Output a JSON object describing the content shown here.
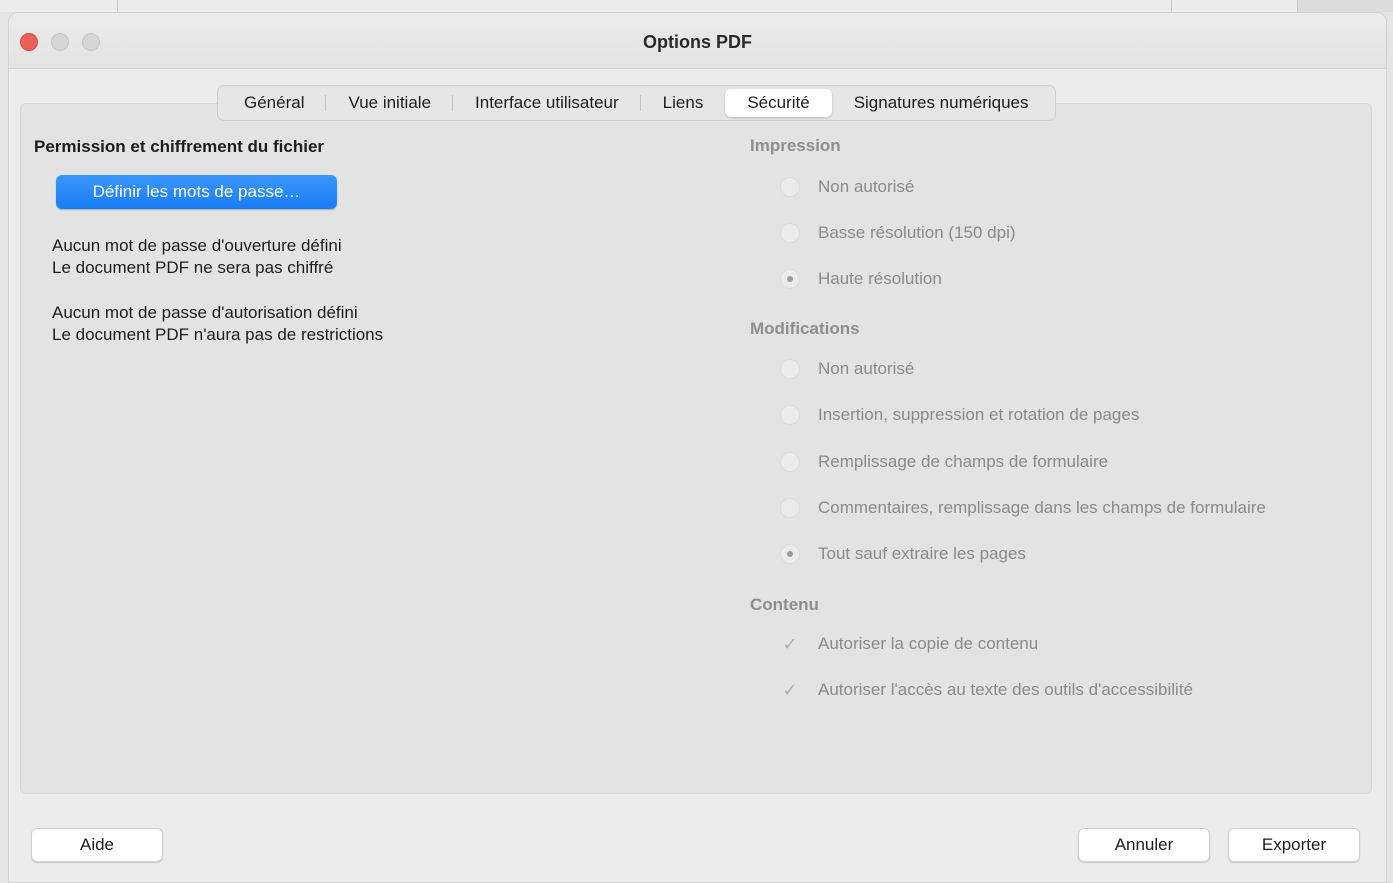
{
  "window": {
    "title": "Options PDF"
  },
  "tabs": [
    {
      "label": "Général"
    },
    {
      "label": "Vue initiale"
    },
    {
      "label": "Interface utilisateur"
    },
    {
      "label": "Liens"
    },
    {
      "label": "Sécurité",
      "active": true
    },
    {
      "label": "Signatures numériques"
    }
  ],
  "left": {
    "title": "Permission et chiffrement du fichier",
    "set_passwords_button": "Définir les mots de passe…",
    "open_pwd_line1": "Aucun mot de passe d'ouverture défini",
    "open_pwd_line2": "Le document PDF ne sera pas chiffré",
    "perm_pwd_line1": "Aucun mot de passe d'autorisation défini",
    "perm_pwd_line2": "Le document PDF n'aura pas de restrictions"
  },
  "printing": {
    "title": "Impression",
    "options": [
      {
        "label": "Non autorisé",
        "selected": false
      },
      {
        "label": "Basse résolution (150 dpi)",
        "selected": false
      },
      {
        "label": "Haute résolution",
        "selected": true
      }
    ]
  },
  "changes": {
    "title": "Modifications",
    "options": [
      {
        "label": "Non autorisé",
        "selected": false
      },
      {
        "label": "Insertion, suppression et rotation de pages",
        "selected": false
      },
      {
        "label": "Remplissage de champs de formulaire",
        "selected": false
      },
      {
        "label": "Commentaires, remplissage dans les champs de formulaire",
        "selected": false
      },
      {
        "label": "Tout sauf extraire les pages",
        "selected": true
      }
    ]
  },
  "content": {
    "title": "Contenu",
    "options": [
      {
        "label": "Autoriser la copie de contenu",
        "checked": true
      },
      {
        "label": "Autoriser l'accès au texte des outils d'accessibilité",
        "checked": true
      }
    ]
  },
  "footer": {
    "help_label": "Aide",
    "cancel_label": "Annuler",
    "export_label": "Exporter"
  },
  "colors": {
    "accent": "#1a7df7",
    "close": "#ee5f57",
    "disabled_text": "#8a8a8a"
  }
}
